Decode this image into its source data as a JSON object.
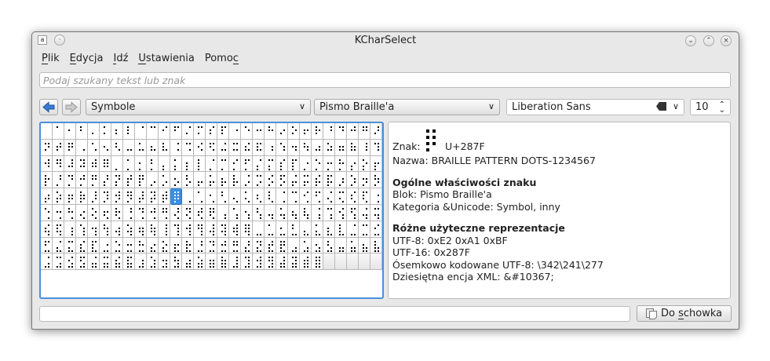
{
  "window": {
    "title": "KCharSelect",
    "app_icon": "a"
  },
  "menu": [
    {
      "label": "Plik",
      "u": 0
    },
    {
      "label": "Edycja",
      "u": 0
    },
    {
      "label": "Idź",
      "u": 0
    },
    {
      "label": "Ustawienia",
      "u": 0
    },
    {
      "label": "Pomoc",
      "u": 4
    }
  ],
  "search": {
    "placeholder": "Podaj szukany tekst lub znak"
  },
  "toolbar": {
    "section": "Symbole",
    "block": "Pismo Braille'a",
    "font": "Liberation Sans",
    "size": "10"
  },
  "grid": {
    "first_codepoint": 10240,
    "count": 256,
    "columns": 29,
    "rows": 9,
    "selected_index": 127
  },
  "info": {
    "char_label": "Znak:",
    "codepoint": "U+287F",
    "name": "Nazwa: BRAILLE PATTERN DOTS-1234567",
    "general_heading": "Ogólne właściwości znaku",
    "block": "Blok: Pismo Braille'a",
    "category": "Kategoria &Unicode: Symbol, inny",
    "repr_heading": "Różne użyteczne reprezentacje",
    "utf8": "UTF-8: 0xE2 0xA1 0xBF",
    "utf16": "UTF-16: 0x287F",
    "octal": "Ósemkowo kodowane UTF-8: \\342\\241\\277",
    "xml": "Dziesiętna encja XML: &#10367;"
  },
  "bottom": {
    "input_value": "",
    "copy_button": "Do schowka",
    "copy_underline": 3
  },
  "colors": {
    "accent": "#3b8de0"
  }
}
